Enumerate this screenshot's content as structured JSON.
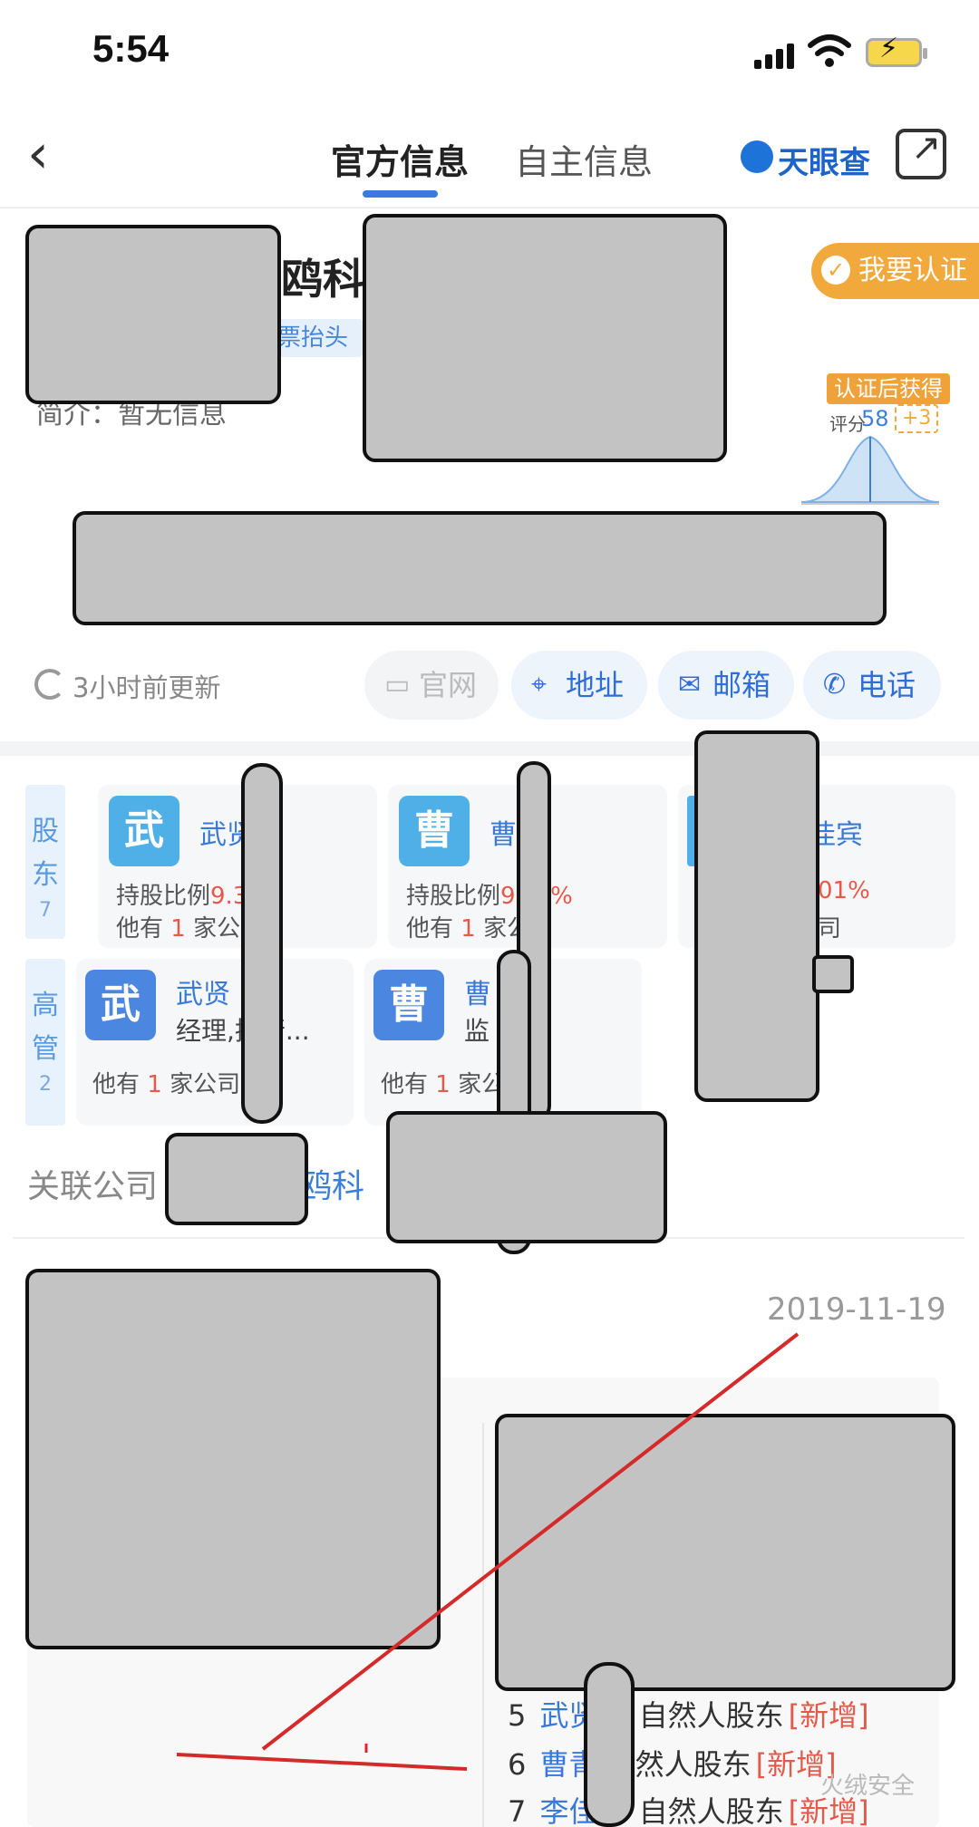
{
  "status_bar": {
    "time": "5:54"
  },
  "nav": {
    "back_glyph": "‹",
    "tab_official": "官方信息",
    "tab_own": "自主信息",
    "brand": "天眼查",
    "accent": "#3a7be0"
  },
  "company": {
    "name_fragment": "鸥科",
    "tag_fragment": "票抬头",
    "intro": "简介：暂无信息",
    "certify_label": "我要认证",
    "cert_gain_label": "认证后获得",
    "score_label": "评分",
    "score_value": "58",
    "score_plus": "+3"
  },
  "update_row": {
    "update_text": "3小时前更新",
    "btn_website": "官网",
    "btn_address": "地址",
    "btn_email": "邮箱",
    "btn_phone": "电话"
  },
  "shareholders": {
    "label": "股东",
    "count": "7",
    "ratio_label": "持股比例",
    "cards": [
      {
        "avatar": "武",
        "name": "武贤",
        "ratio_fragment": "9.3",
        "other": "他有",
        "other_count": "1",
        "other_unit": "家公"
      },
      {
        "avatar": "曹",
        "name": "曹",
        "ratio_fragment": "9",
        "ratio_tail": "3%",
        "other": "他有",
        "other_count": "1",
        "other_unit": "家公"
      },
      {
        "name": "佳宾",
        "ratio_fragment": "01%",
        "other_unit": "司"
      }
    ]
  },
  "managers": {
    "label": "高管",
    "count": "2",
    "cards": [
      {
        "avatar": "武",
        "name": "武贤",
        "role": "经理,执行...",
        "other": "他有",
        "other_count": "1",
        "other_unit": "家公司"
      },
      {
        "avatar": "曹",
        "name": "曹",
        "role": "监",
        "other": "他有",
        "other_count": "1",
        "other_unit": "家公"
      }
    ]
  },
  "related": {
    "label": "关联公司",
    "link_fragment": "鸥科"
  },
  "change": {
    "date": "2019-11-19",
    "rows": [
      {
        "num": "5",
        "name": "武贤",
        "type": "自然人股东",
        "tag": "[新增]"
      },
      {
        "num": "6",
        "name": "曹青",
        "type": "自然人股东",
        "tag": "[新增]"
      },
      {
        "num": "7",
        "name": "李佳",
        "type": "自然人股东",
        "tag": "[新增]"
      }
    ]
  },
  "watermark": "火绒安全"
}
